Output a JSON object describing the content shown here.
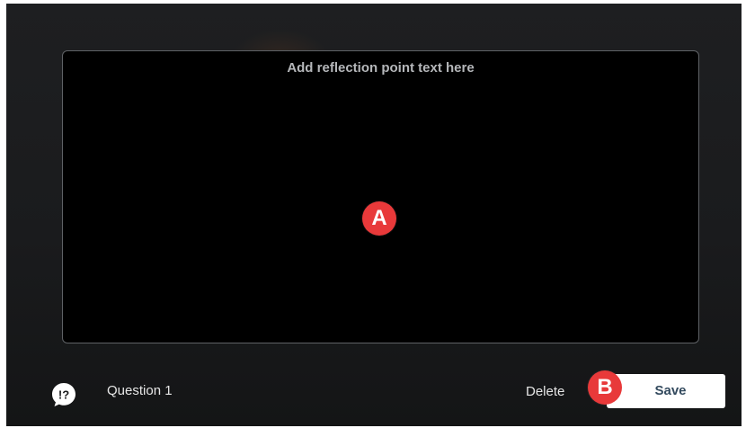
{
  "reflection": {
    "placeholder": "Add reflection point text here"
  },
  "callouts": {
    "a": "A",
    "b": "B"
  },
  "footer": {
    "question_icon": "question-exclamation-bubble-icon",
    "question_label": "Question 1",
    "delete_label": "Delete",
    "save_label": "Save"
  },
  "colors": {
    "background": "#1c1d1f",
    "editor_background": "#000000",
    "callout": "#e8393a",
    "save_text": "#334a5e"
  }
}
